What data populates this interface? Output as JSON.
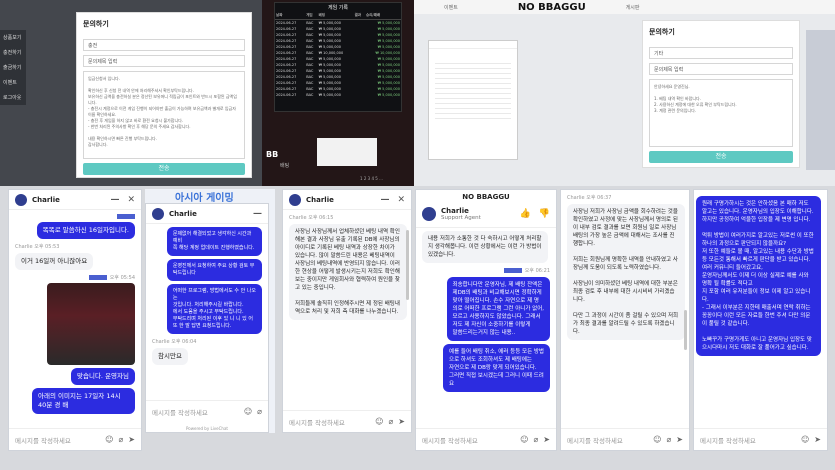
{
  "top1": {
    "sidebar": [
      "상품보기",
      "충전하기",
      "출금하기",
      "이벤트",
      "로그아웃"
    ],
    "modal_title": "문의하기",
    "category": "충전",
    "title_placeholder": "문의제목 입력",
    "body_lines": "입금신청서 입니다.\n\n확인하신 후 신청 전 내역 안에 처리해주셔서 확인부탁드립니다.\n보유하신 금액을 충전하실 분은 정산된 보유머니 적립금이 포인트와 반드시 포함된 금액입니다.\n- 충전시 계정으로 이전 게임 진행이 되어야만 출금이 가능하며 보유금액과 별개로 입금자 이름 확인하세요.\n- 충전 후 게임을 하지 않고 바로 환전 요청시 불가합니다.\n- 한번 처리된 주의사항 확인 후 해당 문의 주세요 감사합니다.\n\n내용 확인하시면 빠른 진행 부탁드립니다.\n감사합니다.",
    "submit": "전송"
  },
  "top2": {
    "header": [
      "날짜",
      "게임",
      "베팅",
      "결과",
      "승리/패배"
    ],
    "title": "게임 기록",
    "rows": [
      [
        "2024-06-27",
        "BAC",
        "₩ 5,000,000",
        "",
        "₩ 5,000,000"
      ],
      [
        "2024-06-27",
        "BAC",
        "₩ 5,000,000",
        "",
        "₩ 5,000,000"
      ],
      [
        "2024-06-27",
        "BAC",
        "₩ 5,000,000",
        "",
        "₩ 5,000,000"
      ],
      [
        "2024-06-27",
        "BAC",
        "₩ 5,000,000",
        "",
        "₩ 5,000,000"
      ],
      [
        "2024-06-27",
        "BAC",
        "₩ 5,000,000",
        "",
        "₩ 5,000,000"
      ],
      [
        "2024-06-27",
        "BAC",
        "₩ 10,000,000",
        "",
        "₩ 10,000,000"
      ],
      [
        "2024-06-27",
        "BAC",
        "₩ 5,000,000",
        "",
        "₩ 5,000,000"
      ],
      [
        "2024-06-27",
        "BAC",
        "₩ 5,000,000",
        "",
        "₩ 5,000,000"
      ],
      [
        "2024-06-27",
        "BAC",
        "₩ 5,000,000",
        "",
        "₩ 5,000,000"
      ],
      [
        "2024-06-27",
        "BAC",
        "₩ 5,000,000",
        "",
        "₩ 5,000,000"
      ],
      [
        "2024-06-27",
        "BAC",
        "₩ 5,000,000",
        "",
        "₩ 5,000,000"
      ],
      [
        "2024-06-27",
        "BAC",
        "₩ 5,000,000",
        "",
        "₩ 5,000,000"
      ],
      [
        "2024-06-27",
        "BAC",
        "₩ 5,000,000",
        "",
        "₩ 5,000,000"
      ]
    ],
    "pagination": "1 2 3 4 5 ...",
    "bb": "BB",
    "bottom_label": "배팅",
    "bottom_label2": "베팅"
  },
  "top3": {
    "brand": "NO BBAGGU",
    "nav": [
      "이벤트",
      "게시판"
    ],
    "modal_title": "문의하기",
    "category": "기타",
    "title_value": "문의제목 입력",
    "body": "안녕하세요 운영진님.\n\n1. 베팅 내역 확인 바랍니다.\n2. 사용하신 계정에 대한 오류 확인 부탁드립니다.\n3. 계정 관련 문의입니다.",
    "submit": "전송"
  },
  "chat1": {
    "agent": "Charlie",
    "msg1": "똑똑로 말씀하신 16일자입니다.",
    "meta2": "Charlie 오후 05:53",
    "msg2": "이거 16일꺼 아니잖아요",
    "meta3": "오후 05:54",
    "msg3": "맞습니다. 운영자님",
    "msg4": "아래의 이미지는 17일자 14시 40분 경 배",
    "composer": "메시지를 작성하세요"
  },
  "chat2": {
    "banner": "아시아 게이밍",
    "agent": "Charlie",
    "msgs": [
      "문제없어 해결되었고 생각하신 시간과 예비\n쪽 해당 계정 업데이트 진행하였습니다.",
      "운영진께서 요청하여 주요 상황 검토 부탁드립니다",
      "어떠한 프로그램, 방법에서도 수 안 나오는\n것입니다. 처리해주시길 바랍니다.\n에서 도움을 주시고 부탁드립니다.\n부탁드리며 처리된 이후 있 니 니 있 어\n또 한 말 답변 요청드립니다."
    ],
    "meta": "Charlie 오후 06:04",
    "reply": "참시만요",
    "composer": "메시지를 작성하세요",
    "powered": "Powered by LiveChat"
  },
  "chat3": {
    "agent": "Charlie",
    "meta": "Charlie 오후 06:15",
    "text": "사장님 사장님께서 업체하셨던 베팅 내역 확인해본 결과 사장님 유출 기록된 DB에 사장님의 아이디로 기록된 베팅 내역과 상장한 차이가 있습니다. 많이 말씀드린 내용은 베팅내역이 사장님의 베팅내역에 반영되지 않습니다. 이러한 현상을 어떻게 발생시키는지 저희도 확인해보는 중이지만 게임회사와 협력하여 원인을 찾고 있는 중입니다.\n\n저희들께 솔직히 인정해주시면 제 정된 배팅내역으로 처리 및 저희 측 대화를 나누겠습니다.",
    "composer": "메시지를 작성하세요"
  },
  "chat4": {
    "brand": "NO BBAGGU",
    "agent": "Charlie",
    "role": "Support Agent",
    "agent_text": "내용 저희가 소통한 것 다 숙하시고 어떻게 처리할지 생각해봅니다. 이런 상황에서는 이런 가 방법이 있겠습니다.",
    "meta": "오후 06:21",
    "msg1": "죄송합니다만 운영자님, 제 배팅 잔액은\n제DB의 배팅과 비교해보시면 정확하게\n맞아 떨어집니다. 손수 자연으로 제 명\n의로 어떠한 프로그램 그런 아니가 없어,\n모르고 사용하지도 않았습니다. 그래서\n저도 제 자신이 소중하기를 이렇게\n말씀드리는거지 않는 내용..",
    "msg2": "예를 들어 배팅 취소, 에러 등등 모든 방법\n으로 하셔도 조회하셔도 제 배팅에는\n자연으로 제 DB랑 맞게 되어있습니다.\n그러면 직접 보시겠는데 그러니 이때 드려\n요",
    "composer": "메시지를 작성하세요"
  },
  "chat5": {
    "meta": "Charlie 오후 06:37",
    "text": "사장님 저희가 사장님 금액을 회수하려는 것을 확인하였고 사정에 맞는 사장님께서 명의로 된 이 내부 검토 결과를 보면 회원님 일로 사장님 배팅의 가장 높은 금액에 대해서는 조사를 진행합니다.\n\n저희는 회원님께 명확한 내역을 안내하였고 사장님께 도움이 되도록 노력하였습니다.\n\n사장님이 의미하셨던 베팅 내역에 대한 부분은 최종 검토 후 내부에 대한 시시비비 가리겠습니다.\n\n다만 그 과정이 시간이 좀 걸릴 수 있으며 저희가 최종 결과를 알려드릴 수 있도록 하겠습니다.",
    "composer": "메시지를 작성하세요"
  },
  "chat6": {
    "text": "원래 구명가하시는 것은 안하셨음 본 매하 저도\n알고는 있습니다. 운영자님의 입장도 이해합니다.\n하지만 공정하여 억울한 입장을 제 변명 입니다.\n\n먹튀 방법이 여러가지로 알고있는 저로썬 이 또한 하나의 과정으로 판단되지 않을까요?\n저 또한 예들로 볼 때, 알고있는 내용 수단과 방법 등 모든것 통해서 빠르게 판단을 받고 있습니다. 여러 커뮤니티 들어갔고요,\n운영자님께서도 이제 더 이상 실제로 예를 사와 명확 될 확률도 적다고\n지 포함 여러 유저분들이 정보 이제 알고 있습니다.\n- 그래서 이부분은 지한테 매출서며 연락 취하는 꽁꽁이다 이런 모든 자료들 한번 주셔 다만 의문이 풀릴 것 같습니다.\n\n노빠꾸가 구명가게도 아니고 운영자님 입장도 맞으시다마시 저도 대화로 잘 풀어가고 싶습니다.",
    "composer": "메시지를 작성하세요"
  }
}
